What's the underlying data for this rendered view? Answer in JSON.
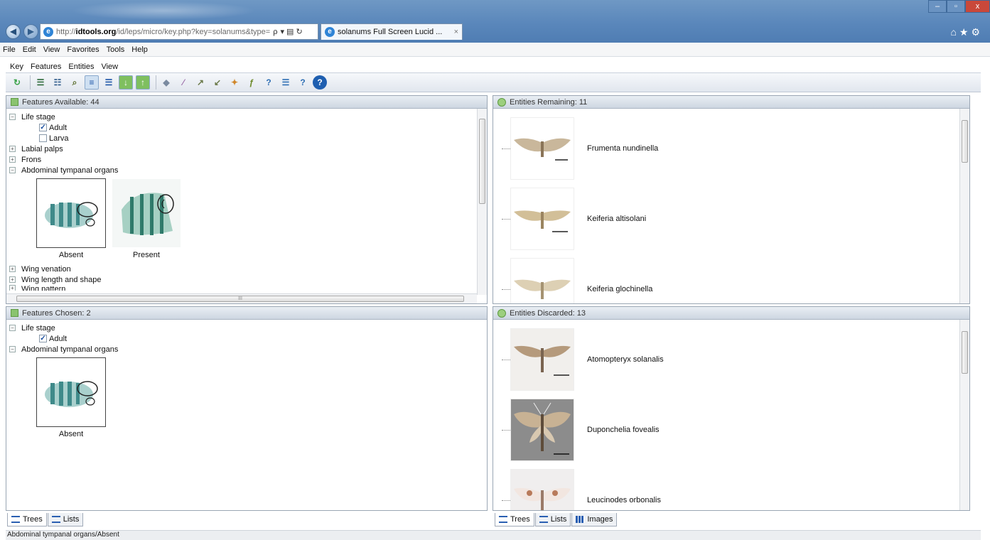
{
  "browser": {
    "address_pre": "http://",
    "address_host": "idtools.org",
    "address_rest": "/id/leps/micro/key.php?key=solanums&type=",
    "tab_title": "solanums Full Screen Lucid ...",
    "tab_close": "×",
    "window_min": "–",
    "window_max": "▫",
    "window_close": "x",
    "right_icons": "⌂★⚙",
    "back": "◀",
    "forward": "▶",
    "search_symbol": "ρ",
    "address_ctls": "▾ ▤ ↻"
  },
  "menubar": [
    "File",
    "Edit",
    "View",
    "Favorites",
    "Tools",
    "Help"
  ],
  "app_menu": [
    "Key",
    "Features",
    "Entities",
    "View"
  ],
  "toolbar_icons": [
    "restart-icon",
    "features-expand-icon",
    "features-collapse-icon",
    "find-icon",
    "tree-view-icon",
    "list-view-icon",
    "download-icon",
    "upload-icon",
    "tag-icon",
    "wand-icon",
    "arrow-icon",
    "arrow-left-icon",
    "pin-icon",
    "feature-score-icon",
    "help-entity-icon",
    "list-icon",
    "question-icon",
    "help-icon"
  ],
  "colors": {
    "accent": "#5a87bb",
    "panel_header": "#cdd6e1",
    "check": "#1a4fa0"
  },
  "features_available": {
    "header": "Features Available: 44",
    "items": [
      {
        "label": "Life stage",
        "toggle": "−"
      },
      {
        "label": "Adult",
        "checked": true
      },
      {
        "label": "Larva",
        "checked": false
      },
      {
        "label": "Labial palps",
        "toggle": "+"
      },
      {
        "label": "Frons",
        "toggle": "+"
      },
      {
        "label": "Abdominal tympanal organs",
        "toggle": "−"
      },
      {
        "label": "Wing venation",
        "toggle": "+"
      },
      {
        "label": "Wing length and shape",
        "toggle": "+"
      },
      {
        "label": "Wing pattern",
        "toggle": "+"
      }
    ],
    "states": [
      {
        "label": "Absent"
      },
      {
        "label": "Present"
      }
    ],
    "hscroll_mark": "III"
  },
  "features_chosen": {
    "header": "Features Chosen: 2",
    "items": [
      {
        "label": "Life stage",
        "toggle": "−"
      },
      {
        "label": "Adult",
        "checked": true
      },
      {
        "label": "Abdominal tympanal organs",
        "toggle": "−"
      }
    ],
    "states": [
      {
        "label": "Absent"
      }
    ]
  },
  "entities_remaining": {
    "header": "Entities Remaining: 11",
    "items": [
      {
        "name": "Frumenta nundinella"
      },
      {
        "name": "Keiferia altisolani"
      },
      {
        "name": "Keiferia glochinella"
      }
    ]
  },
  "entities_discarded": {
    "header": "Entities Discarded: 13",
    "items": [
      {
        "name": "Atomopteryx solanalis"
      },
      {
        "name": "Duponchelia fovealis"
      },
      {
        "name": "Leucinodes orbonalis"
      }
    ]
  },
  "left_tabs": [
    {
      "label": "Trees"
    },
    {
      "label": "Lists"
    }
  ],
  "right_tabs": [
    {
      "label": "Trees"
    },
    {
      "label": "Lists"
    },
    {
      "label": "Images"
    }
  ],
  "status": "Abdominal tympanal organs/Absent"
}
